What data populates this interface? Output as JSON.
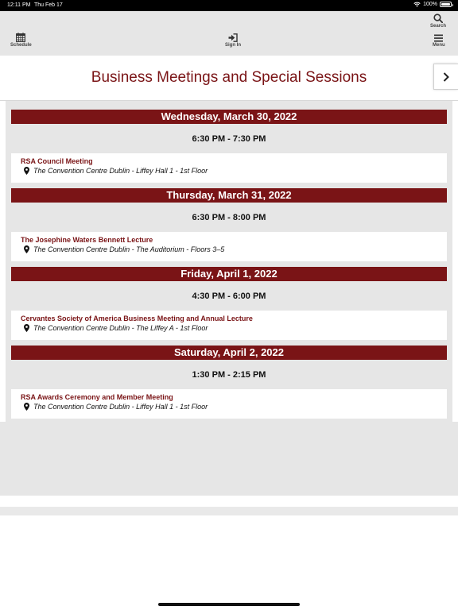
{
  "status_bar": {
    "time": "12:11 PM",
    "date": "Thu Feb 17",
    "battery": "100%"
  },
  "toolbar": {
    "schedule_label": "Schedule",
    "signin_label": "Sign In",
    "search_label": "Search",
    "menu_label": "Menu"
  },
  "header": {
    "title": "Business Meetings and Special Sessions"
  },
  "days": [
    {
      "date": "Wednesday, March 30, 2022",
      "time": "6:30 PM - 7:30 PM",
      "event": "RSA Council Meeting",
      "location": "The Convention Centre Dublin - Liffey Hall 1 - 1st Floor"
    },
    {
      "date": "Thursday, March 31, 2022",
      "time": "6:30 PM - 8:00 PM",
      "event": "The Josephine Waters Bennett Lecture",
      "location": "The Convention Centre Dublin - The Auditorium - Floors 3–5"
    },
    {
      "date": "Friday, April 1, 2022",
      "time": "4:30 PM - 6:00 PM",
      "event": "Cervantes Society of America Business Meeting and Annual Lecture",
      "location": "The Convention Centre Dublin - The Liffey A - 1st Floor"
    },
    {
      "date": "Saturday, April 2, 2022",
      "time": "1:30 PM - 2:15 PM",
      "event": "RSA Awards Ceremony and Member Meeting",
      "location": "The Convention Centre Dublin - Liffey Hall 1 - 1st Floor"
    }
  ],
  "colors": {
    "accent": "#7a1416",
    "background_gray": "#e6e6e6"
  },
  "icons": [
    "calendar-icon",
    "sign-in-icon",
    "search-icon",
    "menu-icon",
    "chevron-right-icon",
    "location-pin-icon",
    "wifi-icon",
    "battery-icon"
  ]
}
